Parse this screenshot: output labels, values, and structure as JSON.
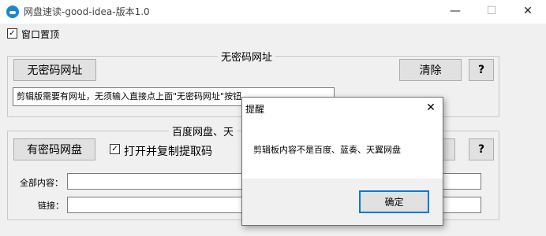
{
  "window": {
    "title": "网盘速读-good-idea-版本1.0",
    "minimize": "—",
    "maximize": "☐",
    "close": "✕"
  },
  "topmost": {
    "label": "窗口置顶",
    "checked": true,
    "mark": "✓"
  },
  "no_password_group": {
    "title": "无密码网址",
    "button": "无密码网址",
    "clear_button": "清除",
    "help_button": "?",
    "hint": "剪辑版需要有网址，无须输入直接点上面\"无密码网址\"按钮"
  },
  "password_group": {
    "title_visible": "百度网盘、天",
    "button": "有密码网盘",
    "copy_code": {
      "label": "打开并复制提取码",
      "checked": true,
      "mark": "✓"
    },
    "help_button": "?",
    "all_content_label": "全部内容：",
    "link_label": "链接："
  },
  "dialog": {
    "title": "提醒",
    "close": "✕",
    "message": "剪辑板内容不是百度、蓝奏、天翼网盘",
    "ok": "确定"
  }
}
